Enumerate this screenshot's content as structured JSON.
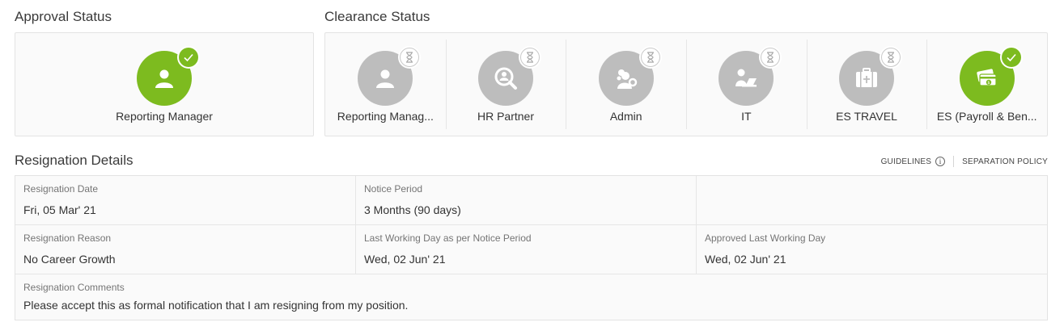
{
  "approval": {
    "title": "Approval Status",
    "stages": [
      {
        "label": "Reporting Manager",
        "status": "approved",
        "icon": "person-icon"
      }
    ]
  },
  "clearance": {
    "title": "Clearance Status",
    "stages": [
      {
        "label": "Reporting Manag...",
        "status": "pending",
        "icon": "person-icon"
      },
      {
        "label": "HR Partner",
        "status": "pending",
        "icon": "search-person-icon"
      },
      {
        "label": "Admin",
        "status": "pending",
        "icon": "admin-gear-person-icon"
      },
      {
        "label": "IT",
        "status": "pending",
        "icon": "person-laptop-icon"
      },
      {
        "label": "ES TRAVEL",
        "status": "pending",
        "icon": "suitcase-icon"
      },
      {
        "label": "ES (Payroll & Ben...",
        "status": "approved",
        "icon": "payroll-card-icon"
      }
    ]
  },
  "resignation": {
    "title": "Resignation Details",
    "links": {
      "guidelines": "GUIDELINES",
      "separation_policy": "SEPARATION POLICY"
    },
    "fields": {
      "resignation_date": {
        "label": "Resignation Date",
        "value": "Fri, 05 Mar' 21"
      },
      "notice_period": {
        "label": "Notice Period",
        "value": "3 Months (90 days)"
      },
      "resignation_reason": {
        "label": "Resignation Reason",
        "value": "No Career Growth"
      },
      "last_working_day_notice": {
        "label": "Last Working Day as per Notice Period",
        "value": "Wed, 02 Jun' 21"
      },
      "approved_last_working_day": {
        "label": "Approved Last Working Day",
        "value": "Wed, 02 Jun' 21"
      },
      "resignation_comments": {
        "label": "Resignation Comments",
        "value": "Please accept this as formal notification that I am resigning from my position."
      }
    }
  },
  "colors": {
    "approved": "#7dbb1f",
    "pending": "#bdbdbd"
  }
}
